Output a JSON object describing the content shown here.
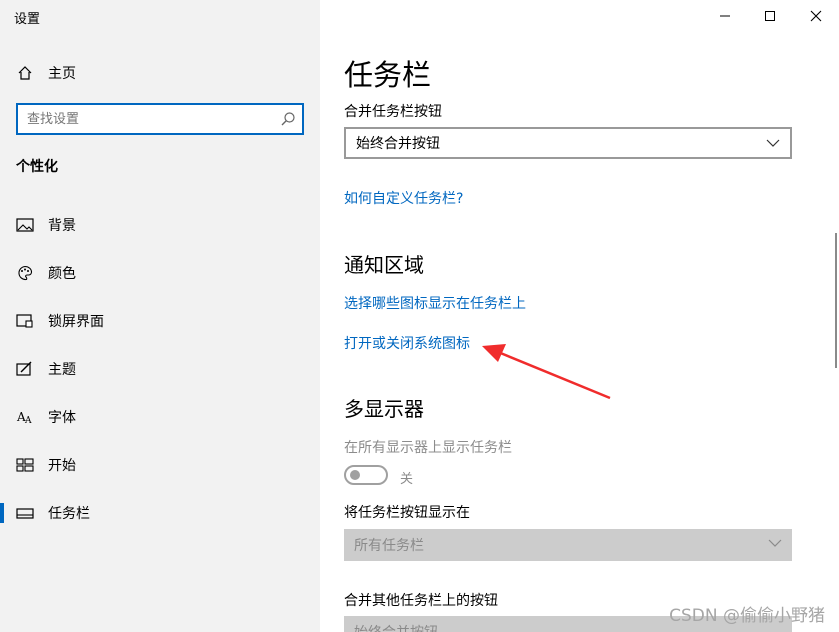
{
  "window": {
    "title": "设置"
  },
  "sidebar": {
    "home": "主页",
    "search_placeholder": "查找设置",
    "section": "个性化",
    "items": [
      {
        "label": "背景",
        "icon": "picture-icon"
      },
      {
        "label": "颜色",
        "icon": "palette-icon"
      },
      {
        "label": "锁屏界面",
        "icon": "lock-screen-icon"
      },
      {
        "label": "主题",
        "icon": "theme-icon"
      },
      {
        "label": "字体",
        "icon": "font-icon"
      },
      {
        "label": "开始",
        "icon": "start-icon"
      },
      {
        "label": "任务栏",
        "icon": "taskbar-icon",
        "active": true
      }
    ]
  },
  "main": {
    "title": "任务栏",
    "combine_label": "合并任务栏按钮",
    "combine_value": "始终合并按钮",
    "customize_link": "如何自定义任务栏?",
    "notify_title": "通知区域",
    "notify_link1": "选择哪些图标显示在任务栏上",
    "notify_link2": "打开或关闭系统图标",
    "multi_title": "多显示器",
    "multi_show_label": "在所有显示器上显示任务栏",
    "toggle_state": "关",
    "show_buttons_label": "将任务栏按钮显示在",
    "show_buttons_value": "所有任务栏",
    "combine_other_label": "合并其他任务栏上的按钮",
    "combine_other_value": "始终合并按钮"
  },
  "watermark": "CSDN @偷偷小野猪",
  "colors": {
    "accent": "#0067c0",
    "sidebar_bg": "#f2f2f2",
    "annotation_arrow": "#f02c2c"
  }
}
